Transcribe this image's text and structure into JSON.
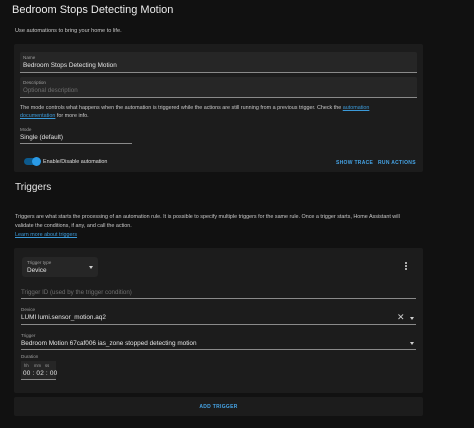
{
  "header": {
    "title": "Bedroom Stops Detecting Motion",
    "subtitle": "Use automations to bring your home to life."
  },
  "details": {
    "name_label": "Name",
    "name_value": "Bedroom Stops Detecting Motion",
    "description_label": "Description",
    "description_placeholder": "Optional description",
    "mode_text_before": "The mode controls what happens when the automation is triggered while the actions are still running from a previous trigger. Check the",
    "mode_link_part1": "automation",
    "mode_link_part2": "documentation",
    "mode_text_after": "for more info.",
    "mode_label": "Mode",
    "mode_value": "Single (default)",
    "toggle_label": "Enable/Disable automation",
    "toggle_on": true,
    "show_trace_label": "SHOW TRACE",
    "run_actions_label": "RUN ACTIONS"
  },
  "triggers": {
    "section_title": "Triggers",
    "intro_line1": "Triggers are what starts the processing of an automation rule. It is possible to specify multiple triggers for the same rule. Once a trigger starts, Home Assistant will",
    "intro_line2": "validate the conditions, if any, and call the action.",
    "learn_more": "Learn more about triggers",
    "trigger_type_label": "Trigger type",
    "trigger_type_value": "Device",
    "trigger_id_placeholder": "Trigger ID (used by the trigger condition)",
    "device_label": "Device",
    "device_value": "LUMI lumi.sensor_motion.aq2",
    "trigger_label": "Trigger",
    "trigger_value": "Bedroom Motion 67caf006 ias_zone stopped detecting motion",
    "duration_label": "Duration",
    "duration_hh_label": "hh",
    "duration_mm_label": "mm",
    "duration_ss_label": "ss",
    "duration_value": "00 : 02 : 00",
    "add_trigger_label": "ADD TRIGGER"
  },
  "colors": {
    "accent": "#46a4e6",
    "background": "#111111",
    "card": "#1c1c1c"
  },
  "icons": [
    "caret-down-icon",
    "kebab-menu-icon",
    "close-icon",
    "toggle-switch"
  ]
}
